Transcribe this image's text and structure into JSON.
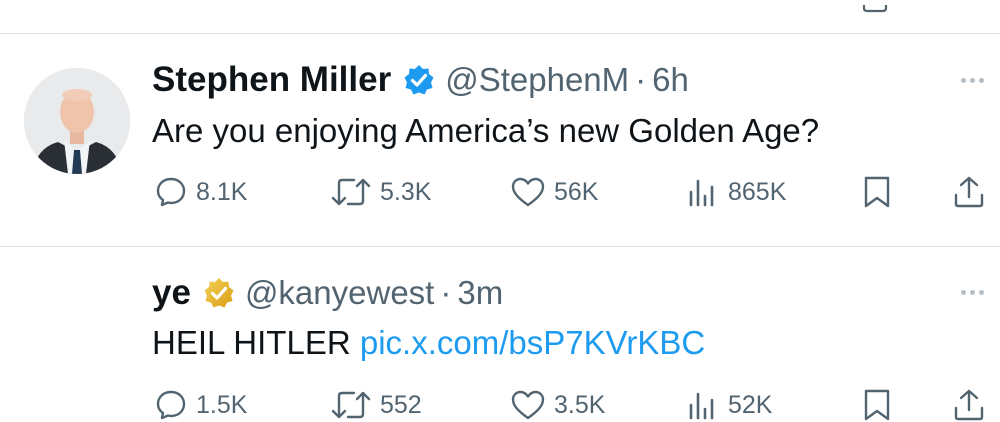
{
  "tweets": [
    {
      "name": "Stephen Miller",
      "badge": "blue-verified-check-icon",
      "handle": "@StephenM",
      "separator": "·",
      "time": "6h",
      "text": "Are you enjoying America’s new Golden Age?",
      "link": "",
      "replies": "8.1K",
      "reposts": "5.3K",
      "likes": "56K",
      "views": "865K"
    },
    {
      "name": "ye",
      "badge": "gold-verified-check-icon",
      "handle": "@kanyewest",
      "separator": "·",
      "time": "3m",
      "text": "HEIL HITLER ",
      "link": "pic.x.com/bsP7KVrKBC",
      "replies": "1.5K",
      "reposts": "552",
      "likes": "3.5K",
      "views": "52K"
    }
  ],
  "colors": {
    "blue_badge": "#1d9bf0",
    "gold_badge": "#e2b719",
    "link": "#1d9bf0",
    "meta": "#536471"
  },
  "icons": [
    "reply-icon",
    "repost-icon",
    "like-icon",
    "views-icon",
    "bookmark-icon",
    "share-icon",
    "more-options-icon"
  ]
}
